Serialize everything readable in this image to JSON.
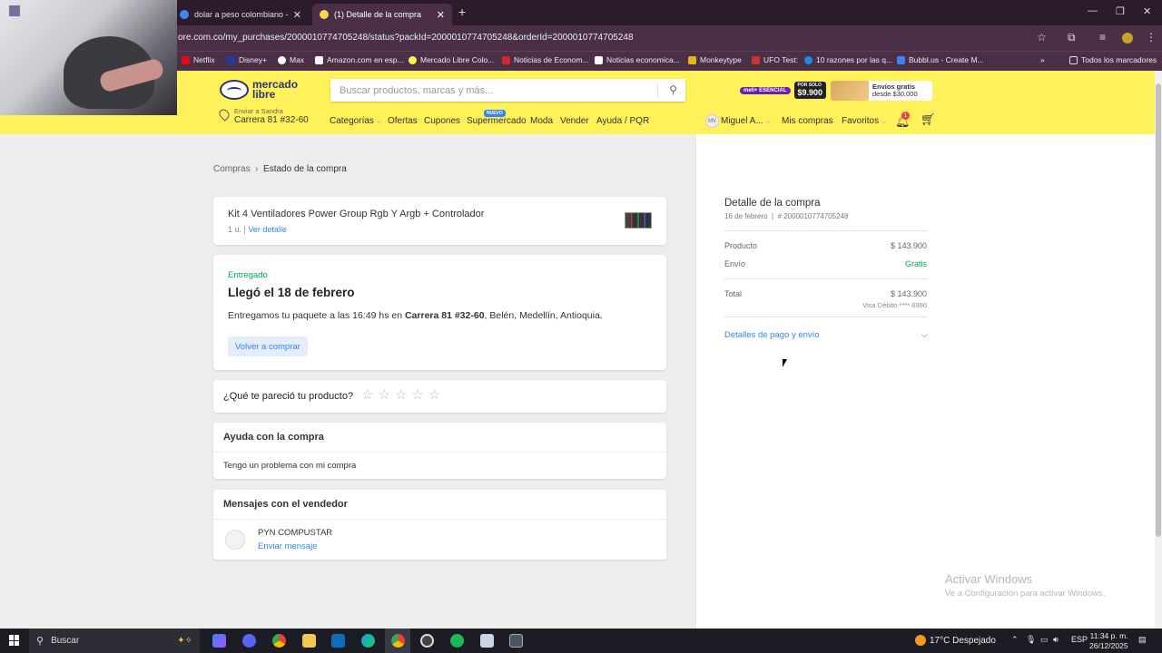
{
  "browser": {
    "tabs": [
      {
        "title": "dolar a peso colombiano - Bus",
        "active": false
      },
      {
        "title": "(1) Detalle de la compra",
        "active": true
      }
    ],
    "url": "ore.com.co/my_purchases/2000010774705248/status?packId=2000010774705248&orderId=2000010774705248",
    "bookmarks": [
      "Netflix",
      "Disney+",
      "Max",
      "Amazon.com en esp...",
      "Mercado Libre Colo...",
      "Noticias de Econom...",
      "Noticias economica...",
      "Monkeytype",
      "UFO Test:",
      "10 razones por las q...",
      "Bubbl.us - Create M..."
    ],
    "all_bookmarks": "Todos los marcadores"
  },
  "header": {
    "logo_line1": "mercado",
    "logo_line2": "libre",
    "search_placeholder": "Buscar productos, marcas y más...",
    "promo_pill": "meli+ ESENCIAL",
    "promo_price_small": "POR SOLO",
    "promo_price": "$9.900",
    "promo_shipping_title": "Envíos gratis",
    "promo_shipping_sub": "desde $30.000",
    "deliver_label": "Enviar a Sandra",
    "deliver_address": "Carrera 81 #32-60",
    "nav": {
      "categorias": "Categorías",
      "ofertas": "Ofertas",
      "cupones": "Cupones",
      "supermercado": "Supermercado",
      "nuevo": "NUEVO",
      "moda": "Moda",
      "vender": "Vender",
      "ayuda": "Ayuda / PQR"
    },
    "avatar_initials": "MV",
    "user_name": "Miguel A...",
    "mis_compras": "Mis compras",
    "favoritos": "Favoritos",
    "notif_count": "1"
  },
  "breadcrumb": {
    "root": "Compras",
    "separator": "›",
    "current": "Estado de la compra"
  },
  "product": {
    "title": "Kit 4 Ventiladores Power Group Rgb Y Argb + Controlador",
    "qty": "1 u.",
    "separator": "|",
    "detail_link": "Ver detalle"
  },
  "delivery": {
    "status": "Entregado",
    "headline": "Llegó el 18 de febrero",
    "msg_prefix": "Entregamos tu paquete a las 16:49 hs en ",
    "msg_bold": "Carrera 81 #32-60",
    "msg_suffix": ", Belén, Medellín, Antioquia.",
    "buy_again": "Volver a comprar"
  },
  "rating": {
    "question": "¿Qué te pareció tu producto?",
    "stars": 0,
    "max_stars": 5
  },
  "help": {
    "title": "Ayuda con la compra",
    "link": "Tengo un problema con mi compra"
  },
  "messages": {
    "title": "Mensajes con el vendedor",
    "seller": "PYN COMPUSTAR",
    "send": "Enviar mensaje"
  },
  "summary": {
    "title": "Detalle de la compra",
    "date": "16 de febrero",
    "order": "# 2000010774705248",
    "rows": [
      {
        "label": "Producto",
        "value": "$ 143.900"
      },
      {
        "label": "Envío",
        "value": "Gratis"
      }
    ],
    "total_label": "Total",
    "total_value": "$ 143.900",
    "card": "Visa Débito **** 6990",
    "details_link": "Detalles de pago y envío"
  },
  "watermark": {
    "line1": "Activar Windows",
    "line2": "Ve a Configuración para activar Windows."
  },
  "taskbar": {
    "search": "Buscar",
    "weather": "17°C  Despejado",
    "lang": "ESP",
    "time": "11:34 p. m.",
    "date": "26/12/2025"
  },
  "colors": {
    "ml_yellow": "#fff159",
    "ml_blue": "#3483fa",
    "ml_green": "#00a650",
    "chrome": "#4a2f47"
  }
}
